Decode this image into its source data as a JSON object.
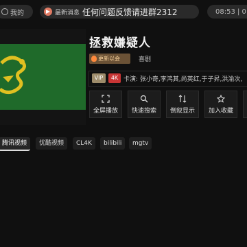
{
  "topbar": {
    "my_label": "我的",
    "news_label": "最新消息",
    "news_text": "任何问题反馈请进群2312",
    "clock": "08:53 | 0"
  },
  "detail": {
    "title": "拯救嫌疑人",
    "status_badge": "更新以会",
    "genre": "喜剧",
    "vip_badge": "VIP",
    "quality_badge": "4K",
    "cast": "卡演: 张小奇,李鸿其,尚英红,于子昇,洪渝次,"
  },
  "actions": [
    {
      "label": "全屏播放",
      "icon": "fullscreen-icon"
    },
    {
      "label": "快速搜索",
      "icon": "search-icon"
    },
    {
      "label": "倒叙显示",
      "icon": "sort-icon"
    },
    {
      "label": "加入收藏",
      "icon": "star-icon"
    }
  ],
  "sources": [
    {
      "label": "腾讯视频",
      "active": true
    },
    {
      "label": "优酷视频",
      "active": false
    },
    {
      "label": "CL4K",
      "active": false
    },
    {
      "label": "bilibili",
      "active": false
    },
    {
      "label": "mgtv",
      "active": false
    }
  ],
  "colors": {
    "background": "#101010",
    "poster_green": "#1f6a2a",
    "vip_gold": "#9e8c6b",
    "quality_red": "#c93535",
    "flame_orange": "#ff8a3d"
  }
}
